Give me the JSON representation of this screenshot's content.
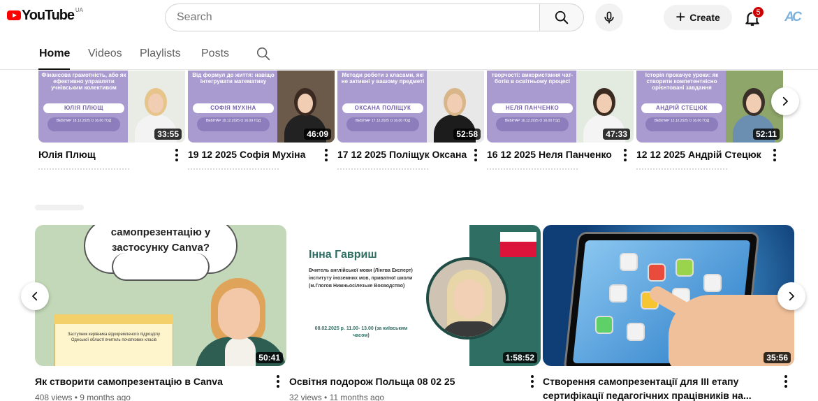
{
  "header": {
    "logo_text": "YouTube",
    "region": "UA",
    "search_placeholder": "Search",
    "create_label": "Create",
    "notification_count": "5",
    "avatar_initials": "AC"
  },
  "tabs": [
    {
      "label": "Home",
      "active": true
    },
    {
      "label": "Videos",
      "active": false
    },
    {
      "label": "Playlists",
      "active": false
    },
    {
      "label": "Posts",
      "active": false
    }
  ],
  "shelf1": {
    "videos": [
      {
        "title": "Юлія Плющ",
        "duration": "33:55",
        "thumb_heading": "Фінансова грамотність, або як ефективно управляти учнівським колективом",
        "thumb_name": "ЮЛІЯ ПЛЮЩ",
        "thumb_webinar": "ВЕБІНАР 18.12.2025 О 16.00 ГОД"
      },
      {
        "title": "19 12 2025 Софія Мухіна",
        "duration": "46:09",
        "thumb_heading": "Від формул до життя: навіщо інтегрувати математику",
        "thumb_name": "СОФІЯ МУХІНА",
        "thumb_webinar": "ВЕБІНАР 19.12.2025 О 16.00 ГОД"
      },
      {
        "title": "17 12 2025 Поліщук Оксана",
        "duration": "52:58",
        "thumb_heading": "Методи роботи з класами, які не активні у вашому предметі",
        "thumb_name": "ОКСАНА ПОЛІЩУК",
        "thumb_webinar": "ВЕБІНАР 17.12.2025 О 16.00 ГОД"
      },
      {
        "title": "16 12 2025 Неля Панченко",
        "duration": "47:33",
        "thumb_heading": "творчості: використання чат-ботів в освітньому процесі",
        "thumb_name": "НЕЛЯ ПАНЧЕНКО",
        "thumb_webinar": "ВЕБІНАР 16.12.2025 О 16.00 ГОД"
      },
      {
        "title": "12 12 2025 Андрій Стецюк",
        "duration": "52:11",
        "thumb_heading": "Історія прокачує уроки: як створити компетентнісно орієнтовані завдання",
        "thumb_name": "АНДРІЙ СТЕЦЮК",
        "thumb_webinar": "ВЕБІНАР 12.12.2025 О 16.00 ГОД"
      }
    ]
  },
  "shelf2": {
    "videos": [
      {
        "title": "Як створити самопрезентацію в Canva",
        "views": "408 views",
        "age": "9 months ago",
        "duration": "50:41",
        "thumb_text": "самопрезентацію у застосунку Canva?",
        "thumb_note": "Заступник керівника відокремленого підрозділу Одеської області вчитель початкових класів"
      },
      {
        "title": "Освітня подорож Польща 08 02 25",
        "views": "32 views",
        "age": "11 months ago",
        "duration": "1:58:52",
        "thumb_name": "Інна Гавриш",
        "thumb_desc": "Вчитель англійської мови (Лінгва Експерт) інституту іноземних мов, приватної школи (м.Глогов Нижньосілезьке Воєводство)",
        "thumb_date": "08.02.2025 р. 11.00- 13.00 (за київським часом)"
      },
      {
        "title": "Створення самопрезентації для ІІІ етапу сертифікації педагогічних працівників на...",
        "duration": "35:56"
      }
    ]
  },
  "colors": {
    "brand_red": "#ff0000",
    "thumb_purple": "#a99bcf",
    "thumb_green": "#d6e4c8",
    "badge_red": "#cc0000"
  }
}
